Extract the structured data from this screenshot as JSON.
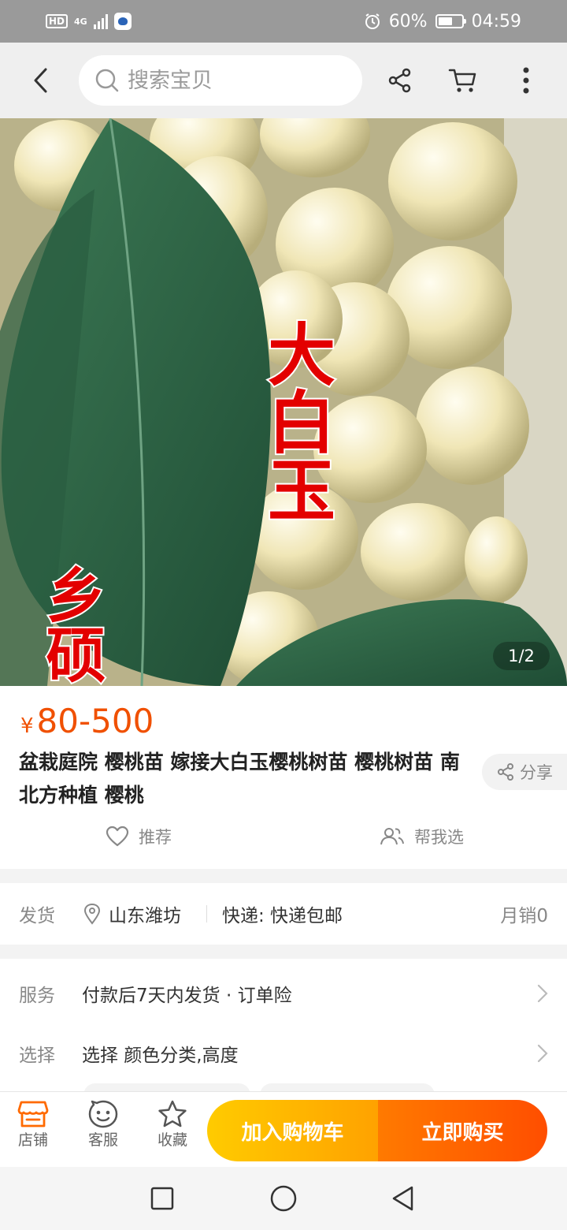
{
  "status_bar": {
    "hd": "HD",
    "network": "4G",
    "battery": "60%",
    "battery_level": 0.6,
    "time": "04:59"
  },
  "top_nav": {
    "search_placeholder": "搜索宝贝",
    "icons": [
      "back-arrow-icon",
      "search-icon",
      "share-icon",
      "cart-icon",
      "more-icon"
    ]
  },
  "hero": {
    "overlay_text_main": "大白玉",
    "overlay_text_watermark": "乡硕",
    "image_counter": "1/2"
  },
  "product": {
    "price_symbol": "¥",
    "price": "80-500",
    "title": "盆栽庭院 樱桃苗 嫁接大白玉樱桃树苗 樱桃树苗 南北方种植 樱桃",
    "share_label": "分享",
    "recommend_label": "推荐",
    "help_choose_label": "帮我选"
  },
  "shipping": {
    "label": "发货",
    "location": "山东潍坊",
    "express": "快递: 快递包邮",
    "monthly_sales": "月销0"
  },
  "service": {
    "label": "服务",
    "value": "付款后7天内发货 · 订单险"
  },
  "select": {
    "label": "选择",
    "value": "选择 颜色分类,高度"
  },
  "bottom_bar": {
    "store_label": "店铺",
    "service_label": "客服",
    "favorite_label": "收藏",
    "add_cart_label": "加入购物车",
    "buy_now_label": "立即购买"
  },
  "colors": {
    "price": "#f05000",
    "store_icon": "#ff6a00",
    "cart_button": "#ffb300",
    "buy_button": "#ff5a00"
  }
}
